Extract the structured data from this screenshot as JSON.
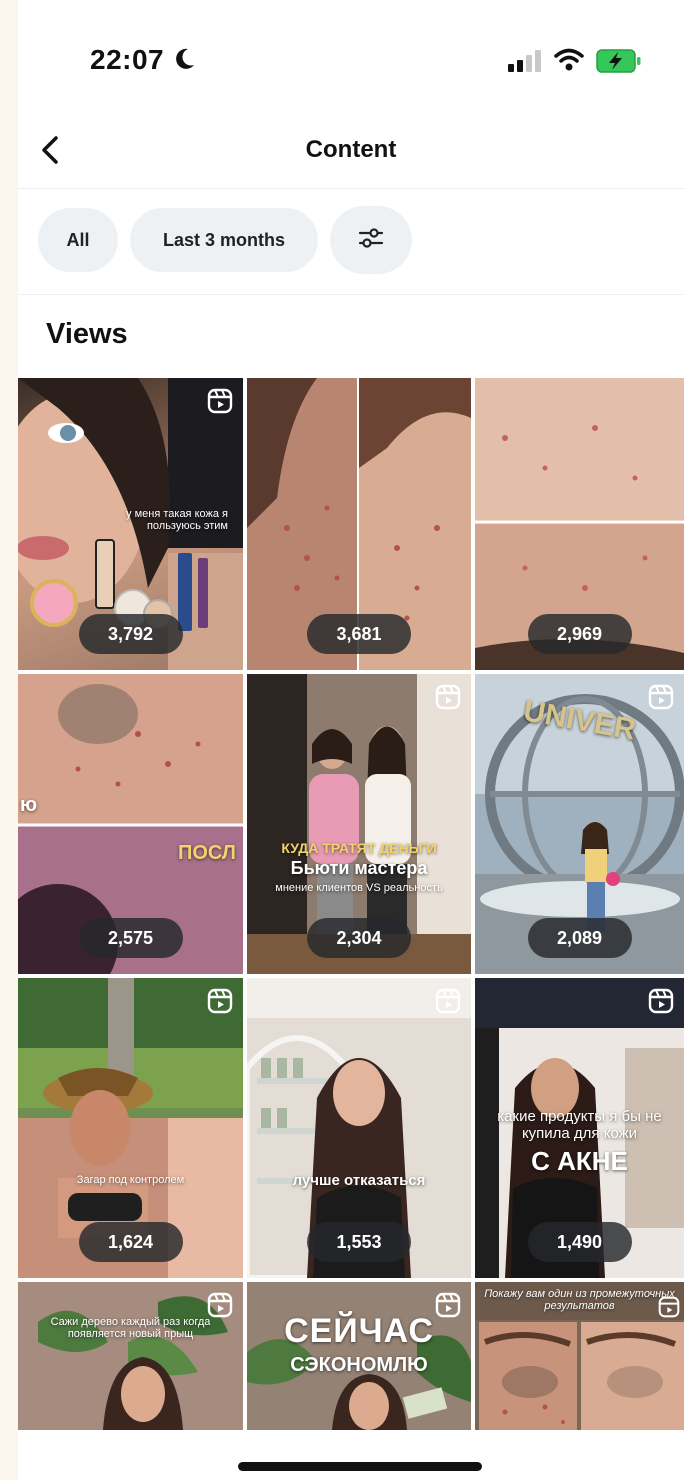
{
  "status_bar": {
    "time": "22:07",
    "icons": [
      "moon-icon",
      "signal-icon",
      "wifi-icon",
      "battery-charging-icon"
    ]
  },
  "header": {
    "title": "Content",
    "back_icon": "chevron-left-icon"
  },
  "filters": {
    "all_label": "All",
    "period_label": "Last 3 months",
    "adjust_icon": "sliders-icon"
  },
  "section": {
    "title": "Views"
  },
  "tiles": [
    {
      "views": "3,792",
      "reel": true,
      "caption": "у меня такая кожа\nя пользуюсь этим",
      "photo": "woman-with-cosmetics"
    },
    {
      "views": "3,681",
      "reel": false,
      "photo": "acne-skin-closeup"
    },
    {
      "views": "2,969",
      "reel": false,
      "photo": "forehead-skin-before-after"
    },
    {
      "views": "2,575",
      "reel": false,
      "caption_side": "ю",
      "caption": "ПОСЛ",
      "photo": "skin-closeup"
    },
    {
      "views": "2,304",
      "reel": true,
      "caption_top": "КУДА ТРАТЯТ ДЕНЬГИ",
      "caption_main": "Бьюти мастера",
      "caption_sub": "мнение клиентов VS реальность",
      "photo": "two-women-hallway"
    },
    {
      "views": "2,089",
      "reel": true,
      "photo": "woman-at-globe-fountain"
    },
    {
      "views": "1,624",
      "reel": true,
      "caption": "Загар под контролем",
      "photo": "woman-in-hat-sunbathing"
    },
    {
      "views": "1,553",
      "reel": true,
      "caption": "лучше отказаться",
      "photo": "woman-in-salon"
    },
    {
      "views": "1,490",
      "reel": true,
      "caption": "какие продукты я бы не купила для кожи",
      "caption_main": "С АКНЕ",
      "photo": "woman-in-store"
    },
    {
      "reel": true,
      "caption": "Сажи дерево каждый раз когда появляется новый прыщ",
      "photo": "woman-with-plant"
    },
    {
      "reel": true,
      "caption_main": "СЕЙЧАС",
      "caption_sub": "СЭКОНОМЛЮ",
      "photo": "woman-with-money"
    },
    {
      "reel": true,
      "caption": "Покажу вам один из промежуточных результатов",
      "photo": "face-skin-comparison"
    }
  ],
  "colors": {
    "chip_bg": "#eef1f3",
    "badge_bg": "#26282c",
    "battery": "#34c759"
  }
}
